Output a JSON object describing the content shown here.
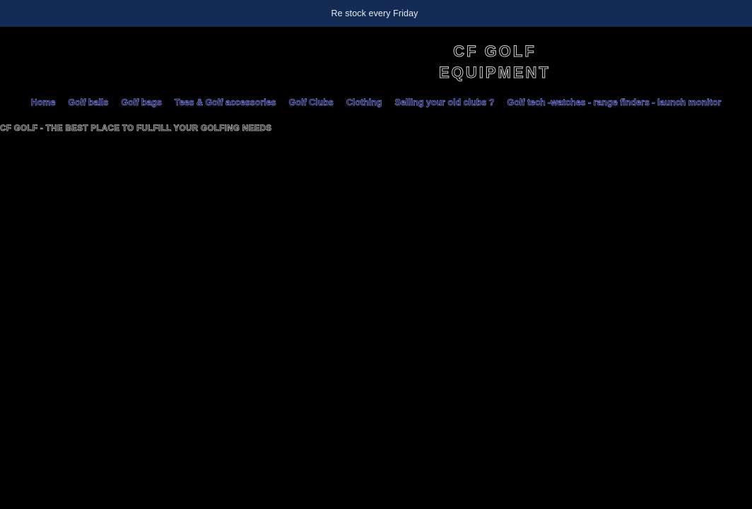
{
  "announcement": {
    "text": "Re stock every Friday"
  },
  "logo": {
    "line1": "CF GOLF",
    "line2": "EQUIPMENT"
  },
  "nav": {
    "items": [
      {
        "label": "Home"
      },
      {
        "label": "Golf balls"
      },
      {
        "label": "Golf bags"
      },
      {
        "label": "Tees & Golf accessories"
      },
      {
        "label": "Golf Clubs"
      },
      {
        "label": "Clothing"
      },
      {
        "label": "Selling your old clubs ?"
      },
      {
        "label": "Golf tech -watches - range finders - launch monitor"
      }
    ]
  },
  "tagline": {
    "text": "CF GOLF - THE BEST PLACE TO FULFILL YOUR GOLFING NEEDS"
  },
  "colors": {
    "announcement_bg": "#132a52",
    "page_bg": "#000000",
    "nav_link": "#7f86ee"
  }
}
